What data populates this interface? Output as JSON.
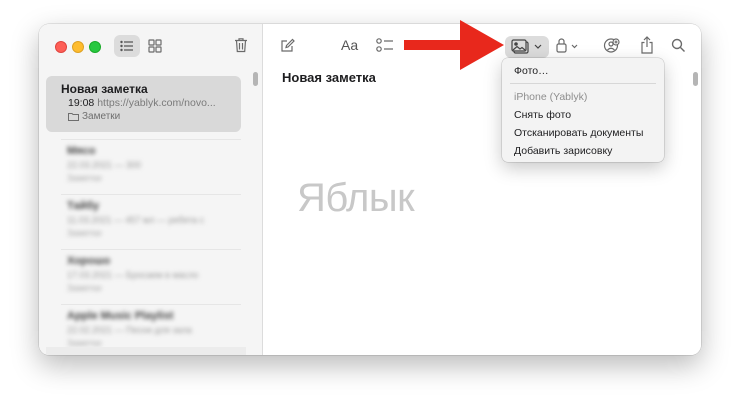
{
  "sidebar": {
    "selected_note": {
      "title": "Новая заметка",
      "time": "19:08",
      "preview": "https://yablyk.com/novo...",
      "folder": "Заметки"
    },
    "blurred_notes": [
      {
        "title": "Мясо",
        "meta": "22.03.2021 — 300",
        "folder": "Заметки"
      },
      {
        "title": "Тайбу",
        "meta": "11.03.2021 — 457 мл — ребята с",
        "folder": "Заметки"
      },
      {
        "title": "Хорошо",
        "meta": "17.03.2021 — Бросаем в маслo",
        "folder": "Заметки"
      },
      {
        "title": "Apple Music Playlist",
        "meta": "22.02.2021 — Песни для зала",
        "folder": "Заметки"
      }
    ]
  },
  "toolbar": {
    "format_label": "Aa"
  },
  "editor": {
    "title": "Новая заметка",
    "watermark": "Яблык"
  },
  "media_menu": {
    "items": [
      {
        "label": "Фото…",
        "kind": "item"
      },
      {
        "label": "iPhone (Yablyk)",
        "kind": "header"
      },
      {
        "label": "Снять фото",
        "kind": "item"
      },
      {
        "label": "Отсканировать документы",
        "kind": "item"
      },
      {
        "label": "Добавить зарисовку",
        "kind": "item"
      }
    ]
  },
  "colors": {
    "close": "#fe5f57",
    "minimize": "#febc2e",
    "zoom": "#28c840",
    "annotation_arrow": "#e8281c"
  }
}
